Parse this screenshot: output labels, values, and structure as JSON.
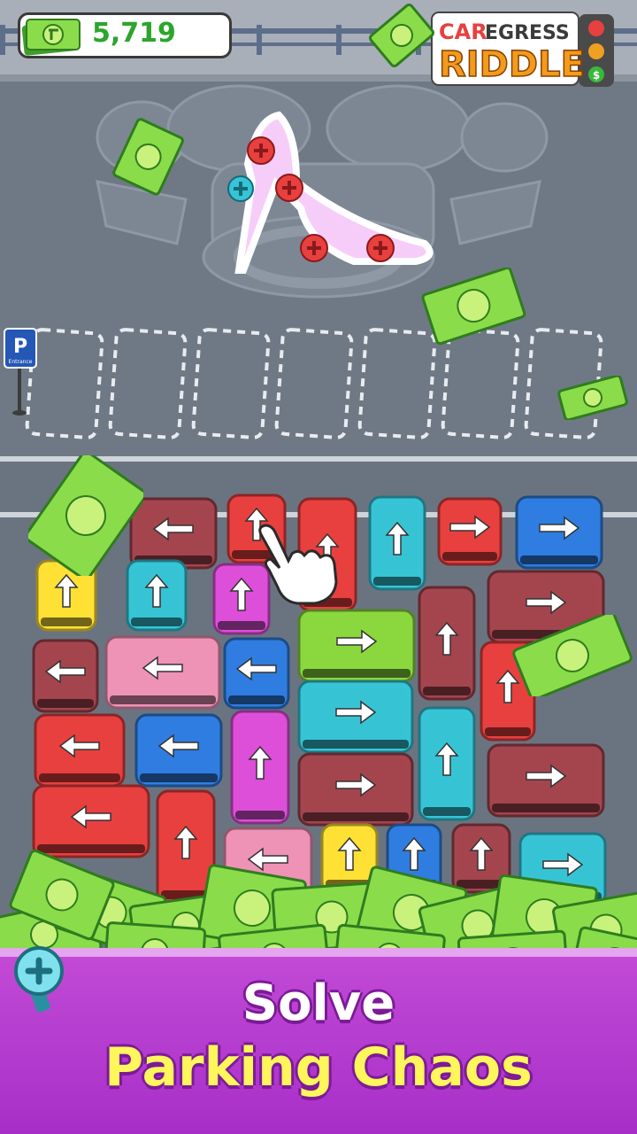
{
  "hud": {
    "coins": "5,719"
  },
  "logo": {
    "line1_a": "CAR",
    "line1_b": "EGRESS",
    "line2": "RIDDLE",
    "dollar": "$"
  },
  "sign": {
    "letter": "P",
    "caption": "Entrance"
  },
  "banner": {
    "line1": "Solve",
    "line2": "Parking Chaos"
  },
  "colors": {
    "red": "#e8403f",
    "blue": "#2f7de0",
    "cyan": "#36c4d6",
    "maroon": "#a4454f",
    "pink": "#ee92b6",
    "yellow": "#ffe135",
    "green": "#8ad83e",
    "magenta": "#dd4fd9"
  },
  "vehicles": [
    {
      "name": "bus-maroon-left",
      "color": "maroon",
      "dir": "left",
      "col": 0
    },
    {
      "name": "car-red-up",
      "color": "red",
      "dir": "up"
    },
    {
      "name": "bus-red-up",
      "color": "red",
      "dir": "up"
    },
    {
      "name": "bus-cyan-up",
      "color": "cyan",
      "dir": "up"
    },
    {
      "name": "car-red-right",
      "color": "red",
      "dir": "right"
    },
    {
      "name": "bus-blue-right",
      "color": "blue",
      "dir": "right"
    },
    {
      "name": "car-yellow-up",
      "color": "yellow",
      "dir": "up"
    },
    {
      "name": "car-cyan-up",
      "color": "cyan",
      "dir": "up"
    },
    {
      "name": "car-magenta-up",
      "color": "magenta",
      "dir": "up"
    },
    {
      "name": "bus-maroon-right",
      "color": "maroon",
      "dir": "right"
    },
    {
      "name": "bus-maroon-up",
      "color": "maroon",
      "dir": "up"
    },
    {
      "name": "car-maroon-left",
      "color": "maroon",
      "dir": "left"
    },
    {
      "name": "bus-pink-left",
      "color": "pink",
      "dir": "left"
    },
    {
      "name": "car-blue-left",
      "color": "blue",
      "dir": "left"
    },
    {
      "name": "bus-green-right",
      "color": "green",
      "dir": "right"
    },
    {
      "name": "car-red-up-2",
      "color": "red",
      "dir": "up"
    },
    {
      "name": "bus-cyan-right",
      "color": "cyan",
      "dir": "right"
    },
    {
      "name": "bus-red-left",
      "color": "red",
      "dir": "left"
    },
    {
      "name": "bus-blue-left",
      "color": "blue",
      "dir": "left"
    },
    {
      "name": "bus-magenta-up",
      "color": "magenta",
      "dir": "up"
    },
    {
      "name": "bus-cyan-up-2",
      "color": "cyan",
      "dir": "up"
    },
    {
      "name": "bus-maroon-right-2",
      "color": "maroon",
      "dir": "right"
    },
    {
      "name": "bus-maroon-right-3",
      "color": "maroon",
      "dir": "right"
    },
    {
      "name": "bus-red-left-2",
      "color": "red",
      "dir": "left"
    },
    {
      "name": "bus-red-up-2",
      "color": "red",
      "dir": "up"
    },
    {
      "name": "bus-pink-left-2",
      "color": "pink",
      "dir": "left"
    },
    {
      "name": "car-yellow-up-2",
      "color": "yellow",
      "dir": "up"
    },
    {
      "name": "car-blue-up",
      "color": "blue",
      "dir": "up"
    },
    {
      "name": "car-maroon-up",
      "color": "maroon",
      "dir": "up"
    },
    {
      "name": "bus-cyan-right-2",
      "color": "cyan",
      "dir": "right"
    }
  ]
}
